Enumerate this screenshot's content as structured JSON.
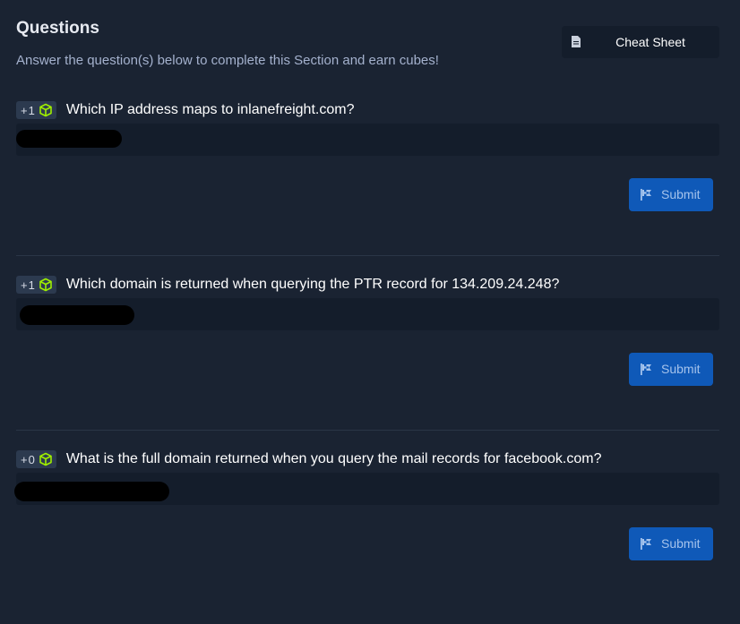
{
  "header": {
    "title": "Questions",
    "subtitle": "Answer the question(s) below to complete this Section and earn cubes!",
    "cheat_sheet_label": "Cheat Sheet",
    "cheat_sheet_icon": "document-icon"
  },
  "questions": [
    {
      "reward": "+1",
      "text": "Which IP address maps to inlanefreight.com?",
      "answer_state": "redacted",
      "submit_label": "Submit"
    },
    {
      "reward": "+1",
      "text": "Which domain is returned when querying the PTR record for 134.209.24.248?",
      "answer_state": "redacted",
      "submit_label": "Submit"
    },
    {
      "reward": "+0",
      "text": "What is the full domain returned when you query the mail records for facebook.com?",
      "answer_state": "redacted",
      "submit_label": "Submit"
    }
  ],
  "colors": {
    "background": "#1a2332",
    "input_background": "#141d2b",
    "submit_button": "#0f59b8",
    "cube_green": "#9fef00"
  }
}
